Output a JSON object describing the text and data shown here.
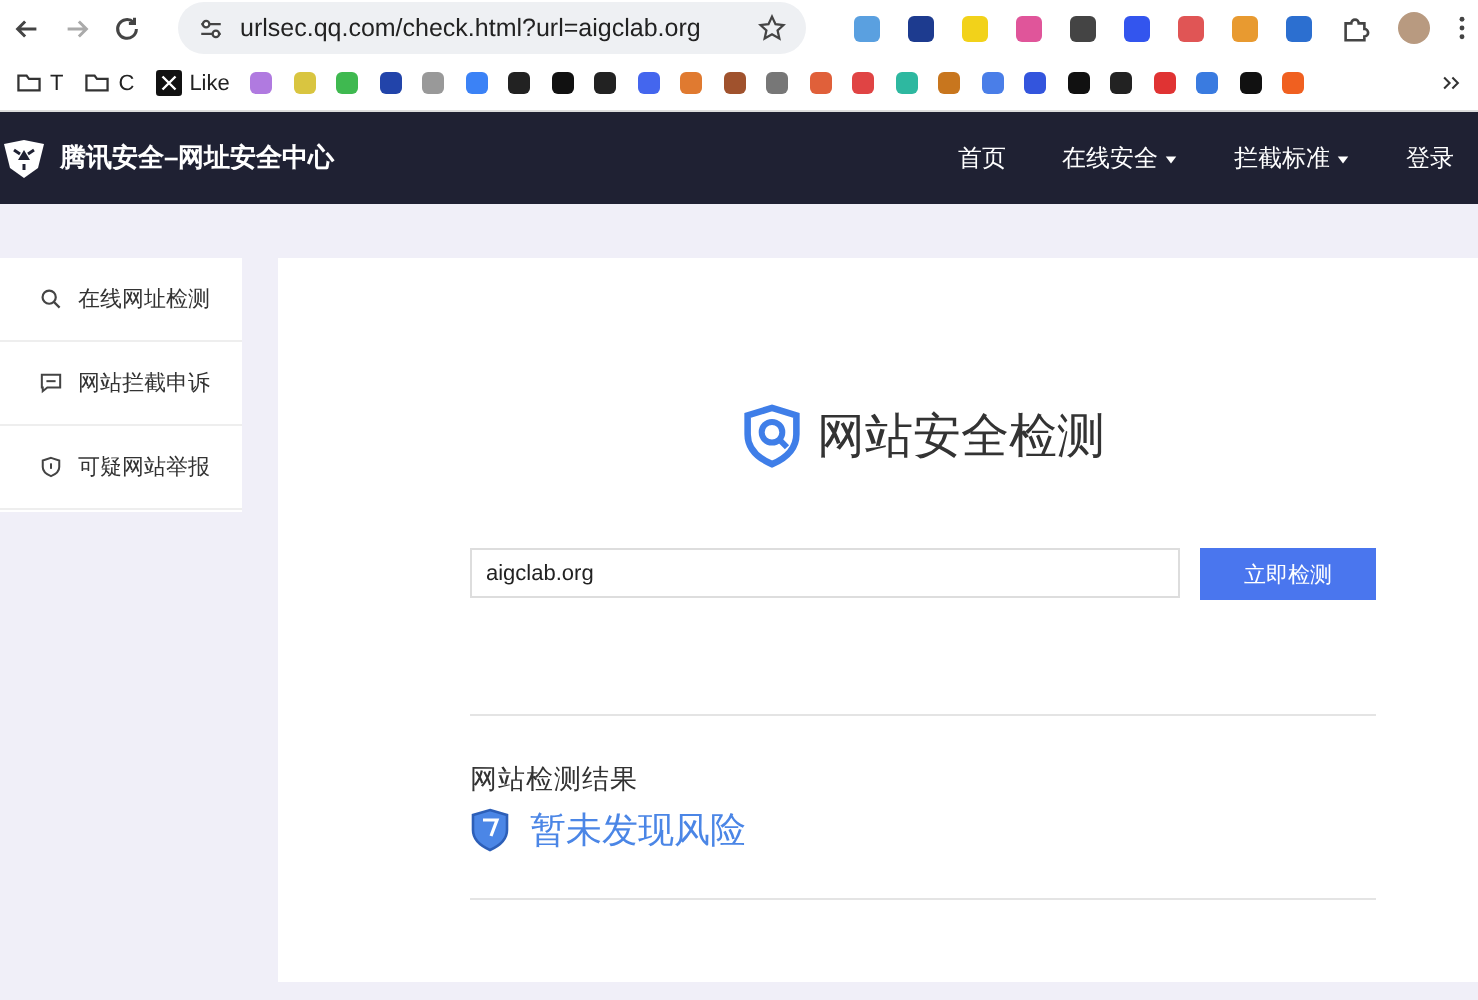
{
  "browser": {
    "url": "urlsec.qq.com/check.html?url=aigclab.org",
    "bookmarks": [
      {
        "kind": "folder",
        "label": "T"
      },
      {
        "kind": "folder",
        "label": "C"
      },
      {
        "kind": "x",
        "label": "Like"
      }
    ]
  },
  "nav": {
    "brand": "腾讯安全–网址安全中心",
    "links": [
      {
        "label": "首页",
        "dropdown": false
      },
      {
        "label": "在线安全",
        "dropdown": true
      },
      {
        "label": "拦截标准",
        "dropdown": true
      },
      {
        "label": "登录",
        "dropdown": false
      }
    ]
  },
  "sidebar": {
    "items": [
      {
        "kind": "search",
        "label": "在线网址检测"
      },
      {
        "kind": "message",
        "label": "网站拦截申诉"
      },
      {
        "kind": "shield",
        "label": "可疑网站举报"
      }
    ]
  },
  "checker": {
    "title": "网站安全检测",
    "input_value": "aigclab.org",
    "button": "立即检测"
  },
  "result": {
    "heading": "网站检测结果",
    "status": "暂未发现风险"
  }
}
